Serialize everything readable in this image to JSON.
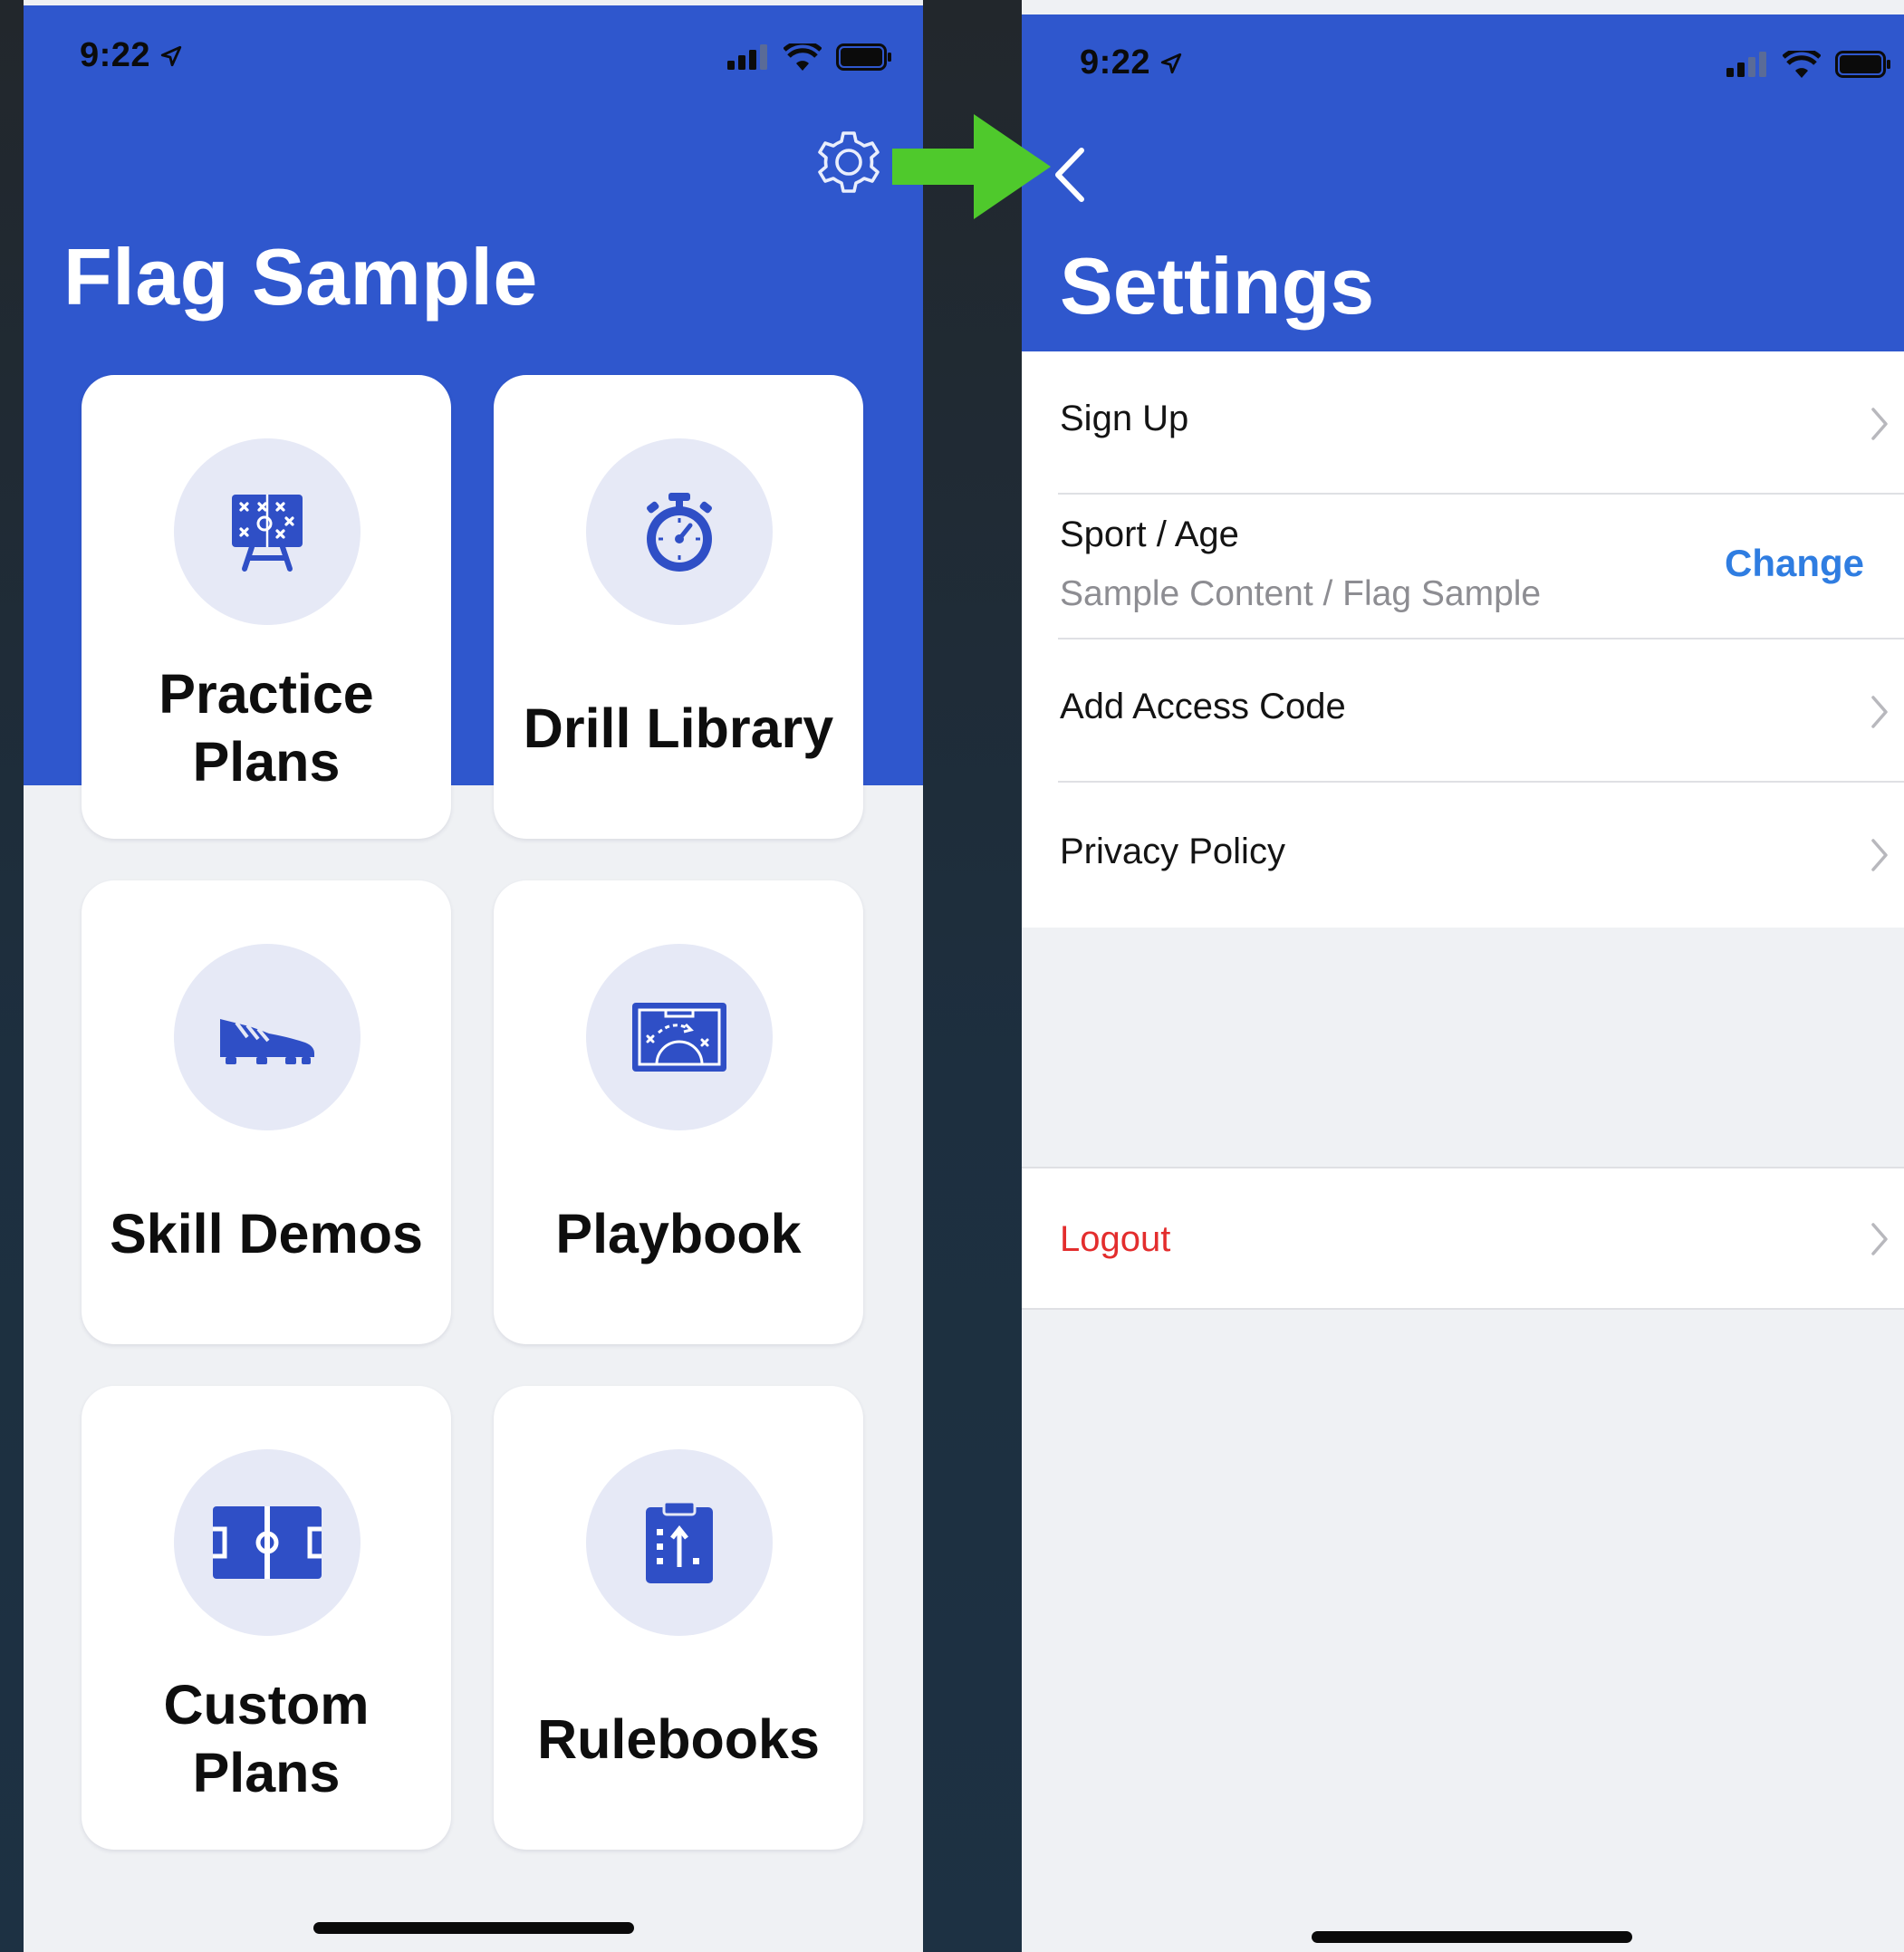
{
  "left_screen": {
    "status": {
      "time": "9:22"
    },
    "title": "Flag Sample",
    "tiles": [
      {
        "label": "Practice Plans",
        "icon": "whiteboard-plays-icon"
      },
      {
        "label": "Drill Library",
        "icon": "stopwatch-icon"
      },
      {
        "label": "Skill Demos",
        "icon": "cleat-shoe-icon"
      },
      {
        "label": "Playbook",
        "icon": "play-diagram-icon"
      },
      {
        "label": "Custom Plans",
        "icon": "field-icon"
      },
      {
        "label": "Rulebooks",
        "icon": "clipboard-icon"
      }
    ],
    "settings_icon": "gear-icon"
  },
  "right_screen": {
    "status": {
      "time": "9:22"
    },
    "title": "Settings",
    "back_icon": "chevron-left-icon",
    "rows": {
      "sign_up": "Sign Up",
      "sport_age": "Sport / Age",
      "sport_age_value": "Sample Content / Flag Sample",
      "change": "Change",
      "add_access_code": "Add Access Code",
      "privacy_policy": "Privacy Policy",
      "logout": "Logout"
    }
  },
  "colors": {
    "header_blue": "#2f57cd",
    "accent_link": "#2f7de1",
    "logout_red": "#e32d2d",
    "arrow_green": "#4fc92c",
    "icon_blue": "#2f4fc6",
    "icon_circle": "#e6e9f6"
  }
}
